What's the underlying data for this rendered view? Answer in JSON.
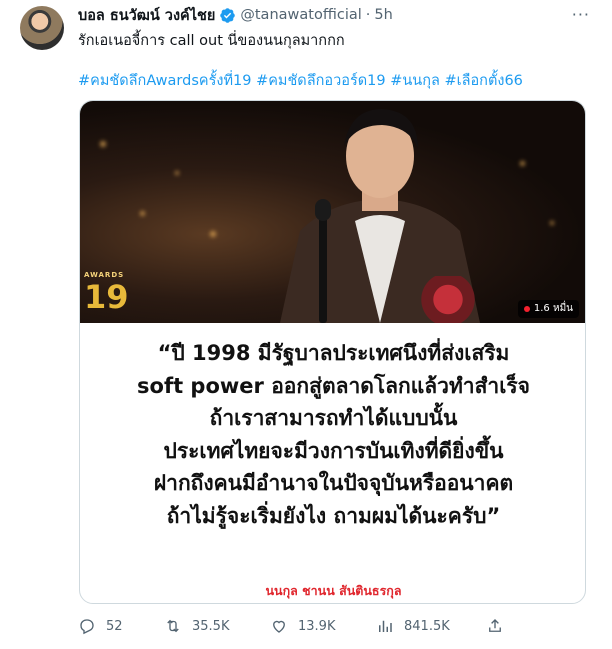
{
  "tweet": {
    "author_name": "บอล ธนวัฒน์ วงค์ไชย",
    "handle": "@tanawatofficial",
    "separator": "·",
    "time": "5h",
    "text": "รักเอเนอจี้การ call out นี่ของนนกุลมากกก",
    "hashtags": [
      "#คมชัดลึกAwardsครั้งที่19",
      "#คมชัดลึกอวอร์ด19",
      "#นนกุล",
      "#เลือกตั้ง66"
    ],
    "more_label": "···"
  },
  "media": {
    "logo_small": "AWARDS",
    "logo_number": "19",
    "views": "1.6 หมื่น",
    "quote_lines": [
      "“ปี 1998 มีรัฐบาลประเทศนึงที่ส่งเสริม",
      "soft power ออกสู่ตลาดโลกแล้วทำสำเร็จ",
      "ถ้าเราสามารถทำได้แบบนั้น",
      "ประเทศไทยจะมีวงการบันเทิงที่ดียิ่งขึ้น",
      "ฝากถึงคนมีอำนาจในปัจจุบันหรืออนาคต",
      "ถ้าไม่รู้จะเริ่มยังไง ถามผมได้นะครับ”"
    ],
    "attribution": "นนกุล ชานน สันตินธรกุล"
  },
  "actions": {
    "replies": "52",
    "retweets": "35.5K",
    "likes": "13.9K",
    "views": "841.5K"
  },
  "colors": {
    "link": "#1d9bf0",
    "muted": "#536471",
    "accent_red": "#e0272e"
  },
  "icons": [
    "verified-icon",
    "more-icon",
    "reply-icon",
    "retweet-icon",
    "like-icon",
    "views-icon",
    "share-icon"
  ]
}
